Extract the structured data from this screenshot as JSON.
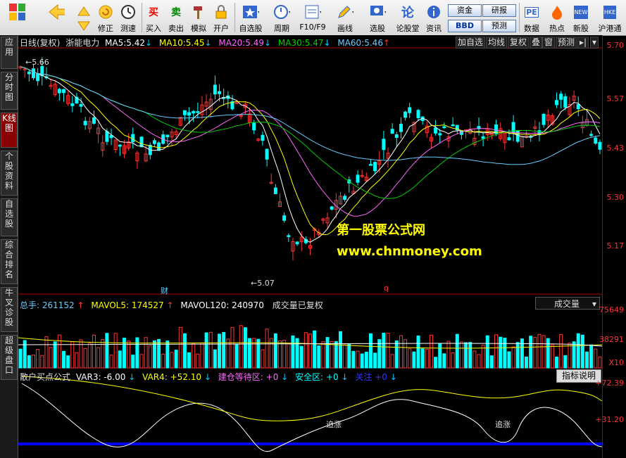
{
  "toolbar": {
    "buttons": [
      {
        "label": "修正"
      },
      {
        "label": "测速"
      },
      {
        "label": "买入"
      },
      {
        "label": "卖出"
      },
      {
        "label": "模拟"
      },
      {
        "label": "开户"
      },
      {
        "label": "自选股"
      },
      {
        "label": "周期"
      },
      {
        "label": "F10/F9"
      },
      {
        "label": "画线"
      },
      {
        "label": "选股"
      },
      {
        "label": "论股堂"
      },
      {
        "label": "资讯"
      },
      {
        "label": "数据"
      },
      {
        "label": "热点"
      },
      {
        "label": "新股"
      },
      {
        "label": "沪港通"
      }
    ],
    "small_buttons": {
      "zijin": "资金",
      "bbd": "BBD",
      "yanbao": "研报",
      "yuce": "预测"
    },
    "icon_glyphs": {
      "mai": "买",
      "mai2": "卖",
      "lun": "论",
      "pe": "PE",
      "new": "NEW",
      "hke": "HKE"
    }
  },
  "sidebar": {
    "tabs": [
      {
        "label": "应用"
      },
      {
        "label": "分时图"
      },
      {
        "label": "K线图"
      },
      {
        "label": "个股资料"
      },
      {
        "label": "自选股"
      },
      {
        "label": "综合排名"
      },
      {
        "label": "牛叉诊股"
      },
      {
        "label": "超级盘口"
      }
    ]
  },
  "main_panel": {
    "period_label": "日线(复权)",
    "stock_name": "浙能电力",
    "ma": [
      {
        "label": "MA5:",
        "value": "5.42",
        "arrow": "↓",
        "color": "#ffffff"
      },
      {
        "label": "MA10:",
        "value": "5.45",
        "arrow": "↓",
        "color": "#ffff00"
      },
      {
        "label": "MA20:",
        "value": "5.49",
        "arrow": "↓",
        "color": "#ff66ff"
      },
      {
        "label": "MA30:",
        "value": "5.47",
        "arrow": "↓",
        "color": "#00cc00"
      },
      {
        "label": "MA60:",
        "value": "5.46",
        "arrow": "↑",
        "color": "#66ccff"
      }
    ],
    "right_buttons": {
      "add": "加自选",
      "avg": "均线",
      "fuquan": "复权",
      "die": "叠",
      "chuang": "窗",
      "yuce": "预测",
      "more": "▸|"
    },
    "price_axis": [
      "5.70",
      "5.57",
      "5.43",
      "5.30",
      "5.17"
    ],
    "high_marker": "5.66",
    "low_marker": "5.07",
    "event_markers": {
      "cai": "财",
      "q": "q"
    }
  },
  "watermark": {
    "line1": "第一股票公式网",
    "line2": "www.chnmoney.com"
  },
  "volume_panel": {
    "total_label": "总手:",
    "total_value": "261152",
    "total_arrow": "↑",
    "mavol5_label": "MAVOL5:",
    "mavol5_value": "174527",
    "mavol5_arrow": "↑",
    "mavol120_label": "MAVOL120:",
    "mavol120_value": "240970",
    "note": "成交量已复权",
    "selector": "成交量",
    "axis": [
      "75649",
      "38291",
      "X10"
    ]
  },
  "indicator_panel": {
    "name": "散户买点公式",
    "var3_label": "VAR3:",
    "var3_value": "-6.00",
    "var3_arrow": "↓",
    "var4_label": "VAR4:",
    "var4_value": "+52.10",
    "var4_arrow": "↓",
    "jc_label": "建仓等待区:",
    "jc_value": "+0",
    "jc_arrow": "↓",
    "aq_label": "安全区:",
    "aq_value": "+0",
    "aq_arrow": "↓",
    "gz_label": "关注",
    "gz_value": "+0",
    "gz_arrow": "↓",
    "help": "指标说明",
    "axis": [
      "+72.39",
      "+31.20"
    ],
    "labels": [
      "追涨",
      "追涨"
    ]
  }
}
